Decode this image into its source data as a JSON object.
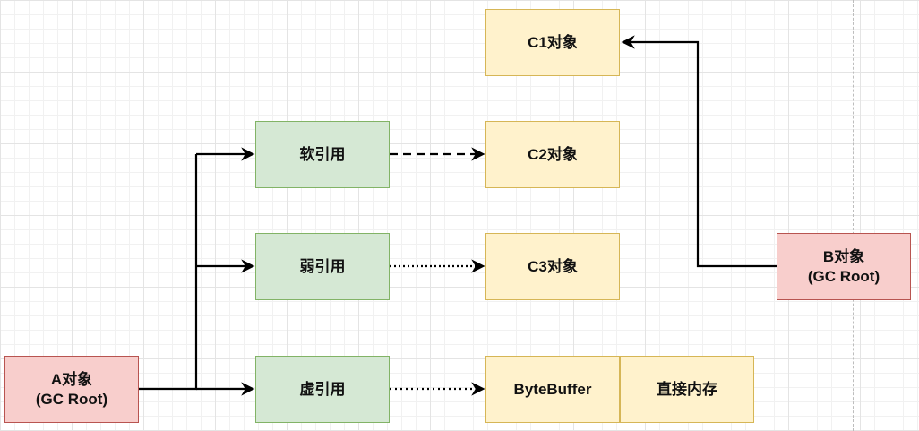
{
  "nodes": {
    "c1": "C1对象",
    "c2": "C2对象",
    "c3": "C3对象",
    "bytebuffer": "ByteBuffer",
    "direct_memory": "直接内存",
    "soft_ref": "软引用",
    "weak_ref": "弱引用",
    "phantom_ref": "虚引用",
    "a_object": "A对象\n(GC Root)",
    "b_object": "B对象\n(GC Root)"
  },
  "colors": {
    "object_fill": "#fff2cc",
    "object_stroke": "#d6b656",
    "reference_fill": "#d5e8d4",
    "reference_stroke": "#82b366",
    "root_fill": "#f8cecc",
    "root_stroke": "#b85450",
    "edge": "#000000"
  }
}
